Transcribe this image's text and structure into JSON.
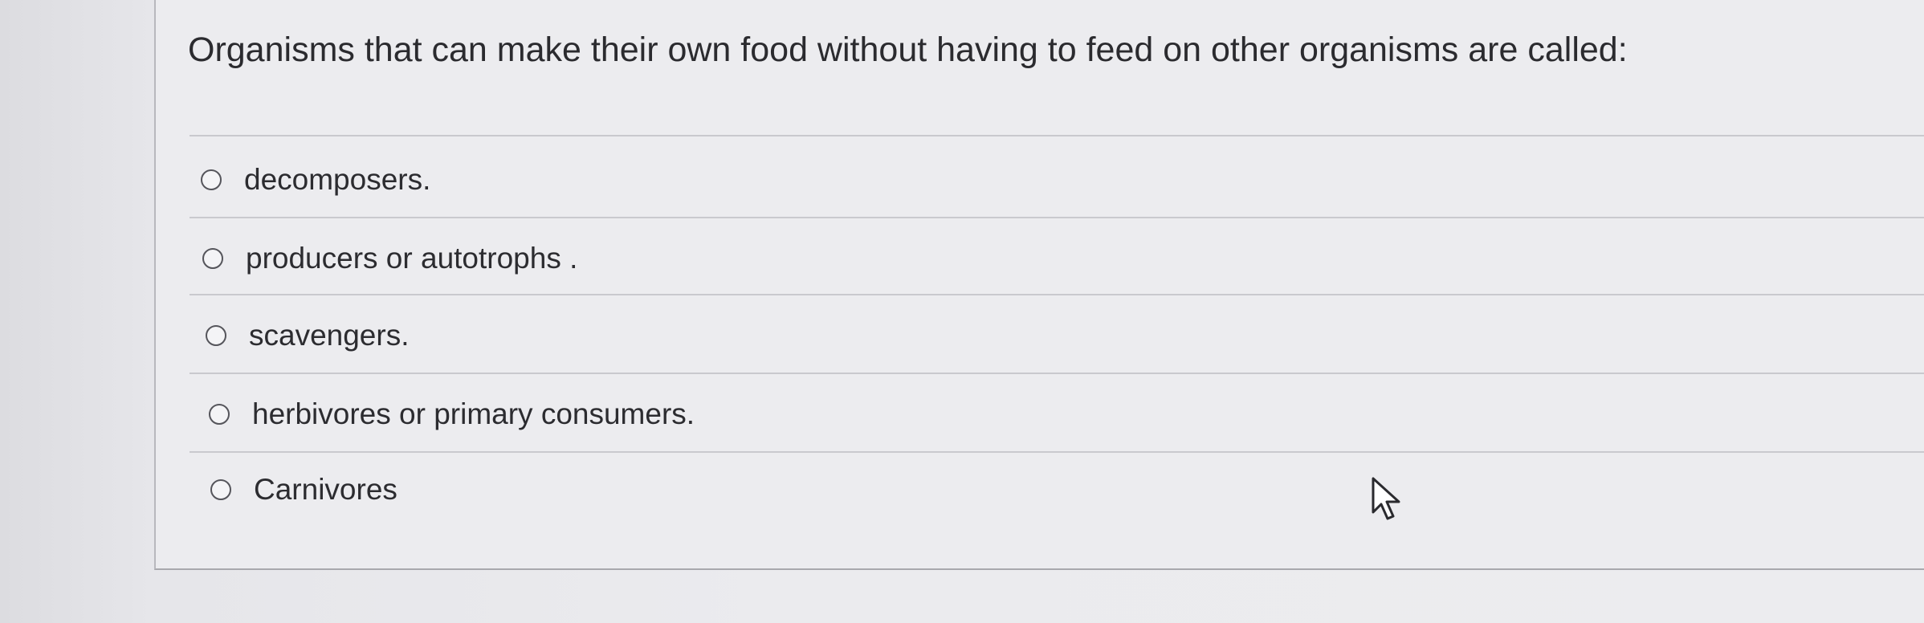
{
  "question": {
    "text": "Organisms that can make their own food without having to feed on other organisms are called:"
  },
  "options": [
    {
      "label": "decomposers."
    },
    {
      "label": "producers or autotrophs ."
    },
    {
      "label": "scavengers."
    },
    {
      "label": "herbivores or primary consumers."
    },
    {
      "label": "Carnivores"
    }
  ],
  "cursor": {
    "icon": "mouse-pointer-icon"
  }
}
